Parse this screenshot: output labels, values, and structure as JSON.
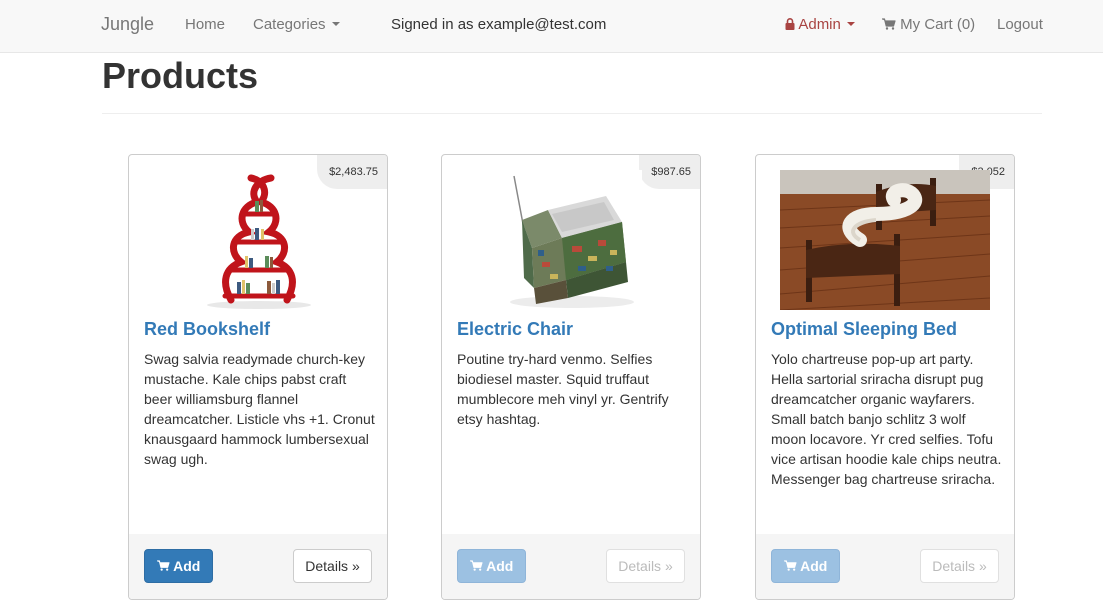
{
  "navbar": {
    "brand": "Jungle",
    "home": "Home",
    "categories": "Categories",
    "signed_in": "Signed in as example@test.com",
    "admin": "Admin",
    "cart": "My Cart (0)",
    "logout": "Logout"
  },
  "page": {
    "title": "Products"
  },
  "products": [
    {
      "name": "Red Bookshelf",
      "price": "$2,483.75",
      "description": "Swag salvia readymade church-key mustache. Kale chips pabst craft beer williamsburg flannel dreamcatcher. Listicle vhs +1. Cronut knausgaard hammock lumbersexual swag ugh.",
      "add_label": "Add",
      "details_label": "Details »"
    },
    {
      "name": "Electric Chair",
      "price": "$987.65",
      "description": "Poutine try-hard venmo. Selfies biodiesel master. Squid truffaut mumblecore meh vinyl yr. Gentrify etsy hashtag.",
      "add_label": "Add",
      "details_label": "Details »"
    },
    {
      "name": "Optimal Sleeping Bed",
      "price": "$3,052",
      "description": "Yolo chartreuse pop-up art party. Hella sartorial sriracha disrupt pug dreamcatcher organic wayfarers. Small batch banjo schlitz 3 wolf moon locavore. Yr cred selfies. Tofu vice artisan hoodie kale chips neutra. Messenger bag chartreuse sriracha.",
      "add_label": "Add",
      "details_label": "Details »"
    }
  ],
  "icons": {
    "lock": "lock-icon",
    "cart": "shopping-cart-icon"
  },
  "colors": {
    "link": "#337ab7",
    "admin": "#a94442",
    "primary": "#337ab7"
  }
}
